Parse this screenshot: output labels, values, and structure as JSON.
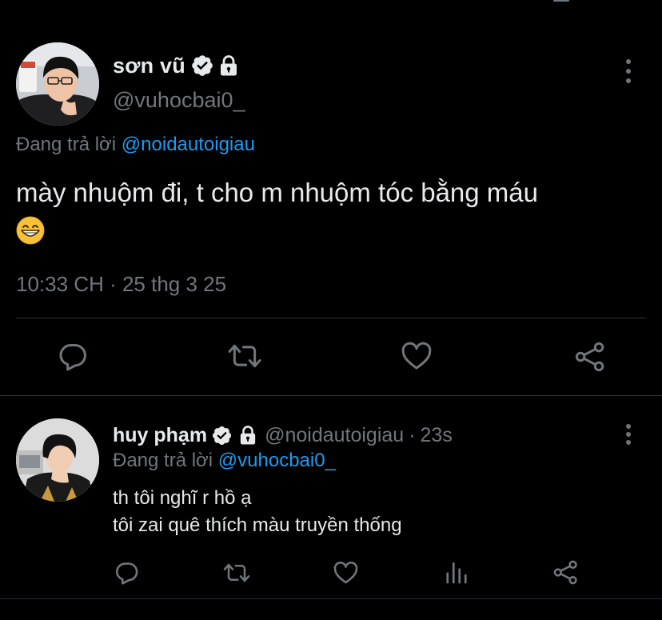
{
  "main_tweet": {
    "display_name": "sơn vũ",
    "handle": "@vuhocbai0_",
    "reply_to_prefix": "Đang trả lời",
    "reply_to_mention": "@noidautoigiau",
    "text": "mày nhuộm đi, t cho m nhuộm tóc bằng máu",
    "emoji": "grinning-face-with-smiling-eyes",
    "timestamp": "10:33 CH · 25 thg 3 25",
    "actions": [
      "reply-icon",
      "retweet-icon",
      "like-icon",
      "share-icon"
    ]
  },
  "reply_tweet": {
    "display_name": "huy phạm",
    "handle": "@noidautoigiau",
    "separator": "·",
    "time": "23s",
    "reply_to_prefix": "Đang trả lời",
    "reply_to_mention": "@vuhocbai0_",
    "text_line1": "th tôi nghĩ r hồ ạ",
    "text_line2": "tôi zai quê thích màu truyền thống",
    "actions": [
      "reply-icon",
      "retweet-icon",
      "like-icon",
      "analytics-icon",
      "share-icon"
    ]
  },
  "colors": {
    "background": "#000000",
    "text_primary": "#e7e9ea",
    "text_secondary": "#71767b",
    "accent": "#1d9bf0",
    "divider": "#2f3336"
  }
}
